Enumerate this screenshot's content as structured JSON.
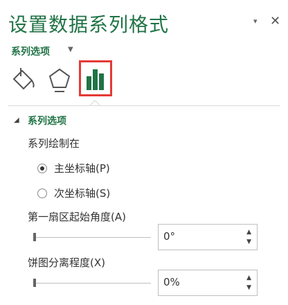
{
  "panel": {
    "title": "设置数据系列格式",
    "pin_glyph": "▾",
    "close_glyph": "✕",
    "options_dropdown_label": "系列选项",
    "options_dropdown_caret": "▼"
  },
  "tabs": [
    {
      "icon": "paint-bucket-icon"
    },
    {
      "icon": "pentagon-icon"
    },
    {
      "icon": "bar-chart-icon",
      "selected": true
    }
  ],
  "section": {
    "caret": "◢",
    "title": "系列选项",
    "plot_on_label": "系列绘制在",
    "radio_primary": "主坐标轴(P)",
    "radio_secondary": "次坐标轴(S)",
    "first_angle_label": "第一扇区起始角度(A)",
    "first_angle_value": "0°",
    "explosion_label": "饼图分离程度(X)",
    "explosion_value": "0%"
  },
  "colors": {
    "accent": "#217346",
    "highlight_border": "#e53935"
  }
}
